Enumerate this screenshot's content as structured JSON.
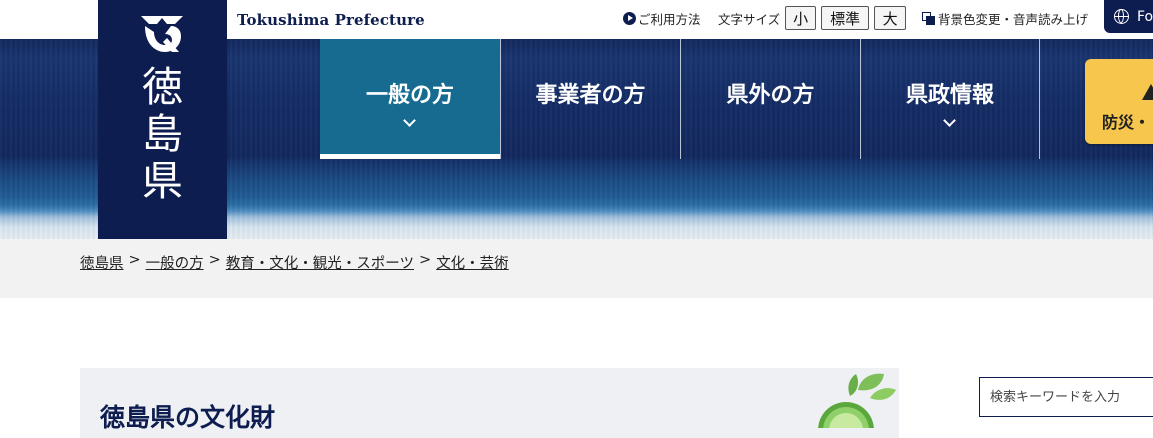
{
  "header": {
    "site_name": "Tokushima Prefecture",
    "logo_text": "徳島県",
    "howto_label": "ご利用方法",
    "fontsize_label": "文字サイズ",
    "fontsize_small": "小",
    "fontsize_standard": "標準",
    "fontsize_large": "大",
    "bgchange_label": "背景色変更・音声読み上げ",
    "language_label": "Fo"
  },
  "nav": {
    "items": [
      {
        "label": "一般の方"
      },
      {
        "label": "事業者の方"
      },
      {
        "label": "県外の方"
      },
      {
        "label": "県政情報"
      }
    ],
    "bousai_label": "防災・"
  },
  "breadcrumb": {
    "items": [
      "徳島県",
      "一般の方",
      "教育・文化・観光・スポーツ",
      "文化・芸術"
    ],
    "separator": ">"
  },
  "main": {
    "page_title": "徳島県の文化財"
  },
  "search": {
    "placeholder": "検索キーワードを入力"
  },
  "colors": {
    "navy": "#0e1d4f",
    "active_tab": "#176b91",
    "bousai_yellow": "#f7c64c"
  }
}
